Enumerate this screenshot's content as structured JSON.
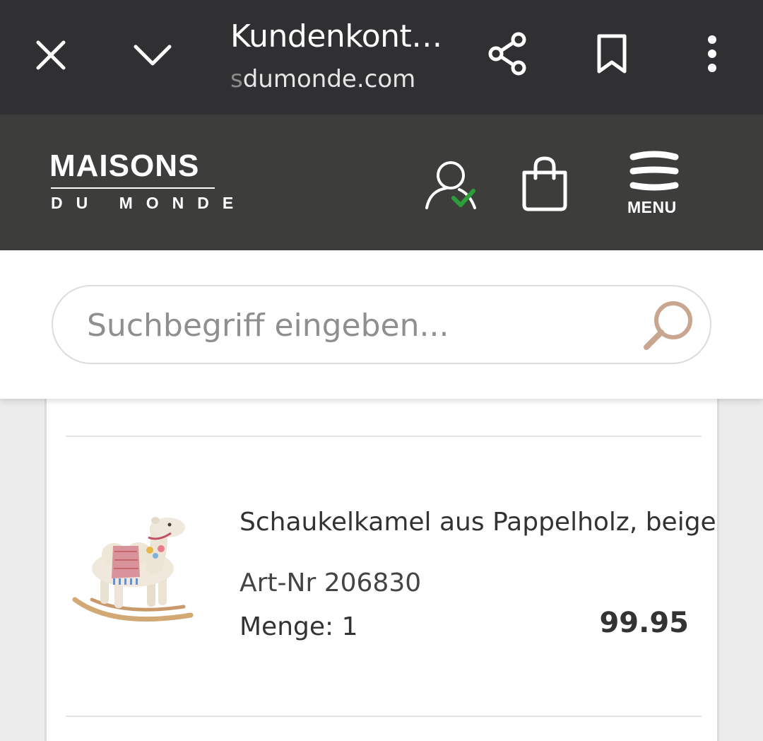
{
  "browser": {
    "title": "Kundenkont…",
    "url_faded": "s",
    "url": "dumonde.com",
    "icons": [
      "close-icon",
      "chevron-down-icon",
      "share-icon",
      "bookmark-icon",
      "more-vert-icon"
    ]
  },
  "header": {
    "logo_main": "MAISONS",
    "logo_sub": "DU MONDE",
    "menu_label": "MENU",
    "icons": [
      "account-icon",
      "check-icon",
      "shopping-bag-icon",
      "hamburger-icon"
    ],
    "check_color": "#2e9e3a"
  },
  "search": {
    "placeholder": "Suchbegriff eingeben...",
    "icon": "search-icon",
    "icon_color": "#c8a690"
  },
  "cart": {
    "items": [
      {
        "name": "Schaukelkamel aus Pappelholz, beige",
        "art_nr": "Art-Nr 206830",
        "quantity": "Menge: 1",
        "price": "99.95",
        "image_icon": "rocking-camel-image"
      }
    ]
  }
}
